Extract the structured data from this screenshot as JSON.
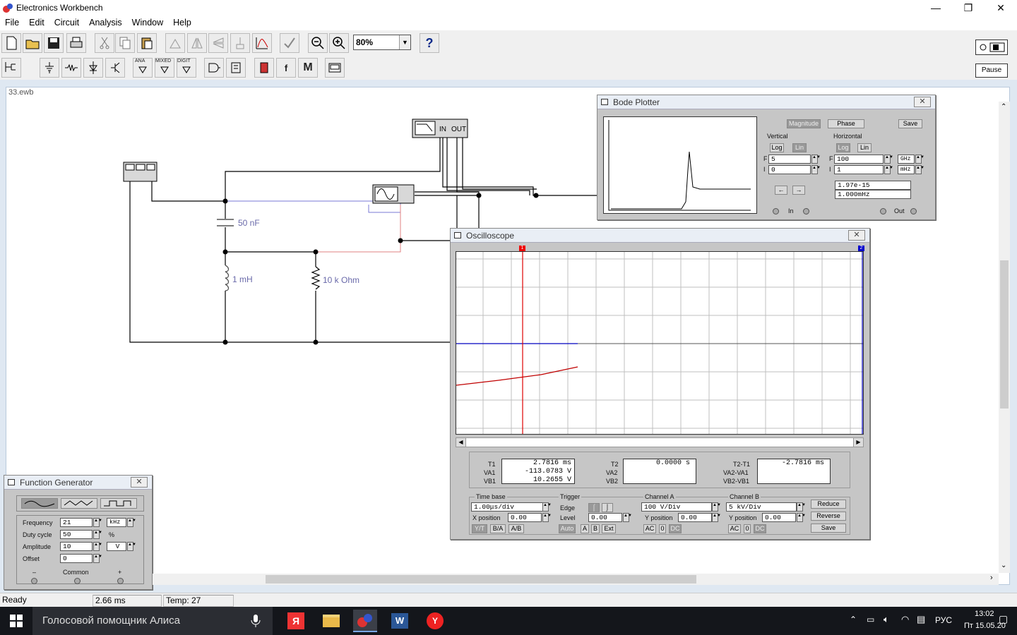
{
  "app": {
    "title": "Electronics Workbench",
    "document": "33.ewb"
  },
  "window_controls": {
    "minimize": "—",
    "maximize": "❐",
    "close": "✕"
  },
  "menu": [
    "File",
    "Edit",
    "Circuit",
    "Analysis",
    "Window",
    "Help"
  ],
  "toolbar": {
    "zoom_value": "80%",
    "help_label": "?",
    "power_label": "I O",
    "pause_label": "Pause",
    "parts_bins": [
      "ANA",
      "MIXED",
      "DIGIT"
    ],
    "m_label": "M",
    "f_label": "f"
  },
  "circuit": {
    "labels": {
      "capacitor": "50 nF",
      "inductor": "1 mH",
      "resistor": "10 k Ohm",
      "bode_in": "IN",
      "bode_out": "OUT"
    }
  },
  "bode_plotter": {
    "title": "Bode Plotter",
    "mode_buttons": {
      "magnitude": "Magnitude",
      "phase": "Phase",
      "save": "Save"
    },
    "vertical": {
      "label": "Vertical",
      "log": "Log",
      "lin": "Lin",
      "f_label": "F",
      "i_label": "I",
      "final": "5",
      "initial": "0"
    },
    "horizontal": {
      "label": "Horizontal",
      "log": "Log",
      "lin": "Lin",
      "f_label": "F",
      "i_label": "I",
      "final": "100",
      "initial": "1",
      "final_unit": "GHz",
      "initial_unit": "mHz"
    },
    "readout": {
      "value": "1.97e-15",
      "freq": "1.000mHz"
    },
    "ports": {
      "in": "In",
      "out": "Out"
    },
    "arrows": {
      "left": "←",
      "right": "→"
    }
  },
  "oscilloscope": {
    "title": "Oscilloscope",
    "markers": {
      "t1": "1",
      "t2": "2"
    },
    "t1": {
      "label_t": "T1",
      "label_a": "VA1",
      "label_b": "VB1",
      "t": "2.7816  ms",
      "va": "-113.0783  V",
      "vb": "10.2655  V"
    },
    "t2": {
      "label_t": "T2",
      "label_a": "VA2",
      "label_b": "VB2",
      "t": "0.0000  s",
      "va": "",
      "vb": ""
    },
    "diff": {
      "label_t": "T2-T1",
      "label_a": "VA2-VA1",
      "label_b": "VB2-VB1",
      "t": "-2.7816  ms",
      "va": "",
      "vb": ""
    },
    "timebase": {
      "label": "Time base",
      "value": "1.00μs/div",
      "xpos_label": "X position",
      "xpos": "0.00",
      "yt": "Y/T",
      "ba": "B/A",
      "ab": "A/B"
    },
    "trigger": {
      "label": "Trigger",
      "edge_label": "Edge",
      "level_label": "Level",
      "level": "0.00",
      "auto": "Auto",
      "a": "A",
      "b": "B",
      "ext": "Ext"
    },
    "channel_a": {
      "label": "Channel A",
      "value": "100  V/Div",
      "ypos_label": "Y position",
      "ypos": "0.00",
      "ac": "AC",
      "zero": "0",
      "dc": "DC"
    },
    "channel_b": {
      "label": "Channel B",
      "value": "5  kV/Div",
      "ypos_label": "Y position",
      "ypos": "0.00",
      "ac": "AC",
      "zero": "0",
      "dc": "DC"
    },
    "buttons": {
      "reduce": "Reduce",
      "reverse": "Reverse",
      "save": "Save"
    }
  },
  "function_generator": {
    "title": "Function Generator",
    "frequency": {
      "label": "Frequency",
      "value": "21",
      "unit": "kHz"
    },
    "duty": {
      "label": "Duty cycle",
      "value": "50",
      "unit": "%"
    },
    "amplitude": {
      "label": "Amplitude",
      "value": "10",
      "unit": "V"
    },
    "offset": {
      "label": "Offset",
      "value": "0"
    },
    "terminals": {
      "minus": "–",
      "common": "Common",
      "plus": "+"
    }
  },
  "status": {
    "state": "Ready",
    "time": "2.66 ms",
    "temp": "Temp:  27"
  },
  "taskbar": {
    "assistant": "Голосовой помощник Алиса",
    "lang": "РУС",
    "time": "13:02",
    "date": "Пт 15.05.20"
  },
  "colors": {
    "channel_a": "#c00000",
    "channel_b": "#0000c0",
    "wire": "#000000"
  }
}
